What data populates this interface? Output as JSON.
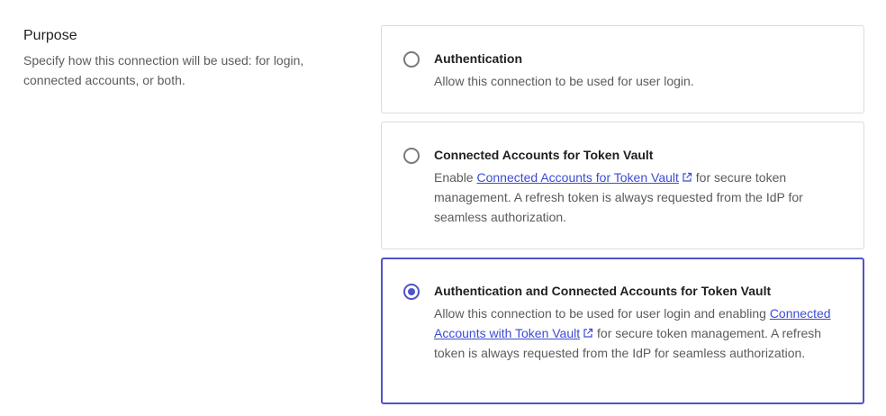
{
  "purpose": {
    "title": "Purpose",
    "description": "Specify how this connection will be used: for login, connected accounts, or both."
  },
  "options": [
    {
      "title": "Authentication",
      "description": "Allow this connection to be used for user login.",
      "selected": false
    },
    {
      "title": "Connected Accounts for Token Vault",
      "desc_prefix": "Enable ",
      "link_text": "Connected Accounts for Token Vault",
      "desc_suffix": " for secure token management. A refresh token is always requested from the IdP for seamless authorization.",
      "selected": false
    },
    {
      "title": "Authentication and Connected Accounts for Token Vault",
      "desc_prefix": "Allow this connection to be used for user login and enabling ",
      "link_text": "Connected Accounts with Token Vault",
      "desc_suffix": " for secure token management. A refresh token is always requested from the IdP for seamless authorization.",
      "selected": true
    }
  ],
  "colors": {
    "accent": "#4f54c8",
    "link": "#3d4bd4",
    "border": "#dcdcdc"
  },
  "icons": {
    "external_link": "external-link-icon"
  }
}
